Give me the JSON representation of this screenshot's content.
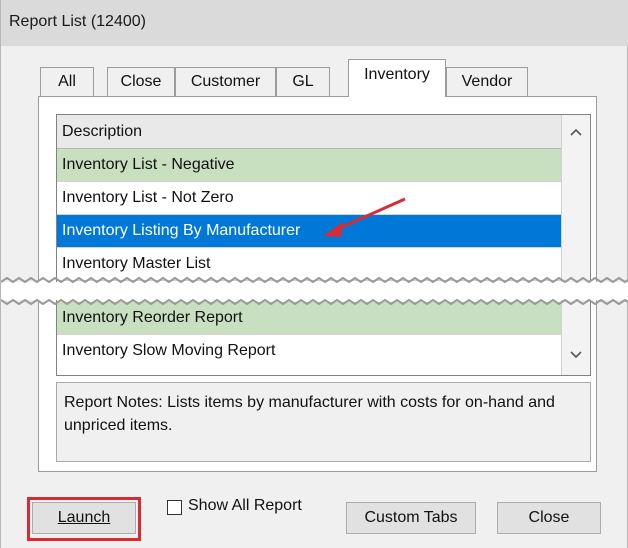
{
  "window": {
    "title": "Report List (12400)"
  },
  "tabs": [
    "All",
    "Close",
    "Customer",
    "GL",
    "Inventory",
    "Vendor"
  ],
  "active_tab": "Inventory",
  "list": {
    "column_header": "Description",
    "rows": [
      "Inventory List - Negative",
      "Inventory List - Not Zero",
      "Inventory Listing By Manufacturer",
      "Inventory Master List",
      "Inventory Reorder Report",
      "Inventory Slow Moving Report"
    ],
    "selected_row": "Inventory Listing By Manufacturer"
  },
  "notes": "Report Notes:  Lists items by manufacturer with costs for on-hand and unpriced items.",
  "buttons": {
    "launch": "Launch",
    "show_all_report": "Show All Report",
    "custom_tabs": "Custom Tabs",
    "close": "Close"
  },
  "colors": {
    "selection": "#0078d7",
    "row_highlight": "#c9e0c0",
    "annotation": "#d62d35"
  },
  "icons": [
    "scroll-up-arrow-icon",
    "scroll-down-arrow-icon",
    "annotation-arrow-icon"
  ]
}
